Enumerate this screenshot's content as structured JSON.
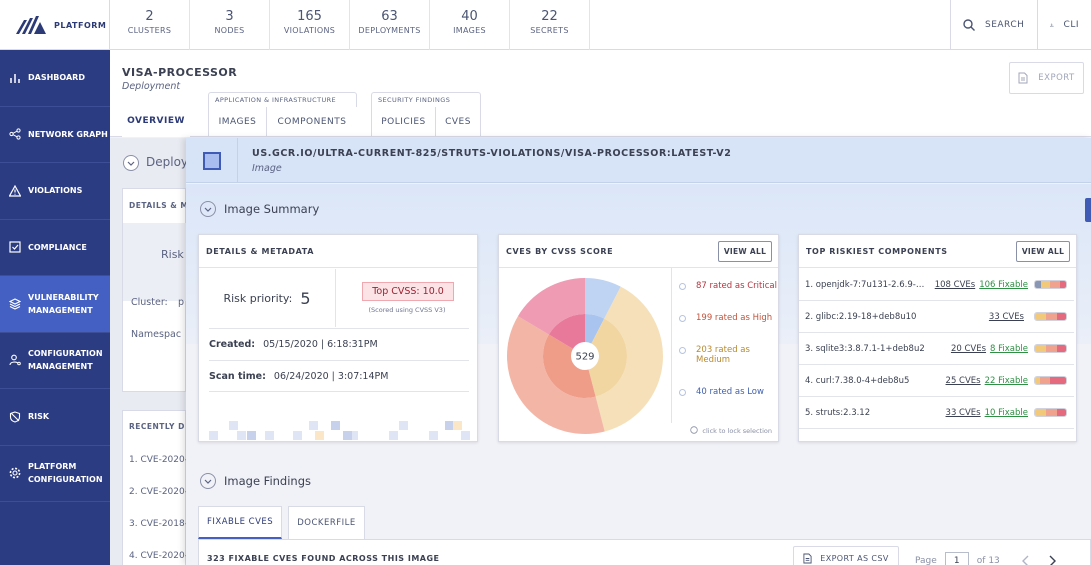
{
  "brand": {
    "label": "PLATFORM"
  },
  "stats": [
    {
      "num": "2",
      "label": "CLUSTERS"
    },
    {
      "num": "3",
      "label": "NODES"
    },
    {
      "num": "165",
      "label": "VIOLATIONS"
    },
    {
      "num": "63",
      "label": "DEPLOYMENTS"
    },
    {
      "num": "40",
      "label": "IMAGES"
    },
    {
      "num": "22",
      "label": "SECRETS"
    }
  ],
  "topbar": {
    "search_label": "SEARCH",
    "cli_label": "CLI"
  },
  "sidebar": {
    "items": [
      {
        "label1": "DASHBOARD",
        "label2": ""
      },
      {
        "label1": "NETWORK GRAPH",
        "label2": ""
      },
      {
        "label1": "VIOLATIONS",
        "label2": ""
      },
      {
        "label1": "COMPLIANCE",
        "label2": ""
      },
      {
        "label1": "VULNERABILITY",
        "label2": "MANAGEMENT"
      },
      {
        "label1": "CONFIGURATION",
        "label2": "MANAGEMENT"
      },
      {
        "label1": "RISK",
        "label2": ""
      },
      {
        "label1": "PLATFORM",
        "label2": "CONFIGURATION"
      }
    ]
  },
  "deployment": {
    "title": "VISA-PROCESSOR",
    "subtitle": "Deployment",
    "export_label": "EXPORT",
    "group_app_infra": "APPLICATION & INFRASTRUCTURE",
    "group_security": "SECURITY FINDINGS",
    "tabs": {
      "overview": "OVERVIEW",
      "images": "IMAGES",
      "components": "COMPONENTS",
      "policies": "POLICIES",
      "cves": "CVES"
    },
    "behind": {
      "deploy": "Deploy",
      "details": "DETAILS & M",
      "risk": "Risk",
      "cluster": "Cluster:",
      "cluster_val": "p",
      "namespace": "Namespac",
      "recently": "RECENTLY D",
      "rows": [
        "1. CVE-2020-",
        "2. CVE-2020-1",
        "3. CVE-2018-1",
        "4. CVE-2020-1"
      ]
    }
  },
  "image": {
    "name": "US.GCR.IO/ULTRA-CURRENT-825/STRUTS-VIOLATIONS/VISA-PROCESSOR:LATEST-V2",
    "type": "Image",
    "summary_title": "Image Summary",
    "findings_title": "Image Findings"
  },
  "details_card": {
    "title": "DETAILS & METADATA",
    "risk_label": "Risk priority:",
    "risk_value": "5",
    "top_cvss": "Top CVSS: 10.0",
    "cvss_note": "(Scored using CVSS V3)",
    "created_label": "Created:",
    "created_value": "05/15/2020 | 6:18:31PM",
    "scan_label": "Scan time:",
    "scan_value": "06/24/2020 | 3:07:14PM"
  },
  "cvss_card": {
    "title": "CVES BY CVSS SCORE",
    "view_all": "VIEW ALL",
    "total": "529",
    "legend": [
      {
        "text": "87 rated as Critical",
        "color": "#b7343f"
      },
      {
        "text": "199 rated as High",
        "color": "#c0543e"
      },
      {
        "text": "203 rated as Medium",
        "color": "#b88a2e"
      },
      {
        "text": "40 rated as Low",
        "color": "#3f5fae"
      }
    ],
    "lock_note": "click to lock selection"
  },
  "chart_data": {
    "type": "pie",
    "title": "CVES BY CVSS SCORE",
    "center_label": "529",
    "slices": [
      {
        "name": "Critical",
        "value": 87,
        "color": "#e8799a"
      },
      {
        "name": "High",
        "value": 199,
        "color": "#ef9c88"
      },
      {
        "name": "Medium",
        "value": 203,
        "color": "#f2d6a2"
      },
      {
        "name": "Low",
        "value": 40,
        "color": "#a9c4ee"
      }
    ]
  },
  "components_card": {
    "title": "TOP RISKIEST COMPONENTS",
    "view_all": "VIEW ALL",
    "rows": [
      {
        "name": "1. openjdk-7:7u131-2.6.9-2...",
        "cves": "108 CVEs",
        "fixable": "106 Fixable"
      },
      {
        "name": "2. glibc:2.19-18+deb8u10",
        "cves": "33 CVEs",
        "fixable": ""
      },
      {
        "name": "3. sqlite3:3.8.7.1-1+deb8u2",
        "cves": "20 CVEs",
        "fixable": "8 Fixable"
      },
      {
        "name": "4. curl:7.38.0-4+deb8u5",
        "cves": "25 CVEs",
        "fixable": "22 Fixable"
      },
      {
        "name": "5. struts:2.3.12",
        "cves": "33 CVEs",
        "fixable": "10 Fixable"
      }
    ]
  },
  "findings": {
    "tab_fixable": "FIXABLE CVES",
    "tab_dockerfile": "DOCKERFILE",
    "count_text": "323 FIXABLE CVES FOUND ACROSS THIS IMAGE",
    "export_csv": "EXPORT AS CSV",
    "page_label": "Page",
    "page_value": "1",
    "page_total": "of 13"
  }
}
